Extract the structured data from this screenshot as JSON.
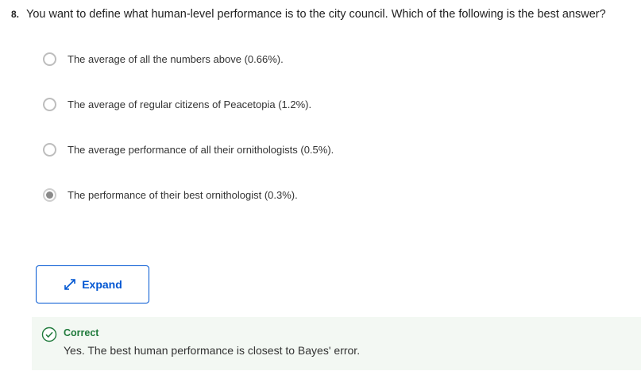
{
  "question": {
    "number": "8.",
    "text": "You want to define what human-level performance is to the city council. Which of the following is the best answer?"
  },
  "options": [
    {
      "label": "The average of all the numbers above (0.66%).",
      "selected": false
    },
    {
      "label": "The average of regular citizens of Peacetopia (1.2%).",
      "selected": false
    },
    {
      "label": "The average performance of all their ornithologists (0.5%).",
      "selected": false
    },
    {
      "label": "The performance of their best ornithologist (0.3%).",
      "selected": true
    }
  ],
  "expand_button": {
    "label": "Expand",
    "icon": "expand-arrows-icon"
  },
  "feedback": {
    "status": "Correct",
    "message": "Yes. The best human performance is closest to Bayes' error.",
    "icon": "check-circle-icon"
  },
  "colors": {
    "accent": "#0056d2",
    "correct": "#1f7a3b",
    "feedback_bg": "#f3f8f3"
  }
}
